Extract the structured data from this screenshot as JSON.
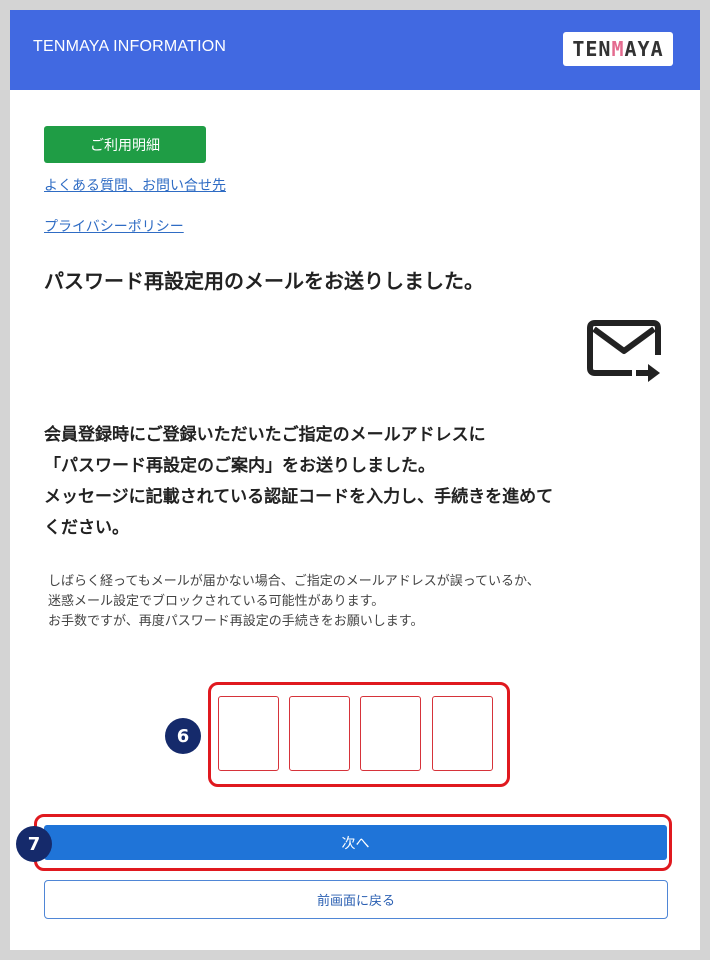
{
  "header": {
    "title": "TENMAYA INFORMATION",
    "logo": {
      "part1": "TEN",
      "part2": "M",
      "part3": "AYA"
    },
    "color": "#4169e1"
  },
  "links": {
    "usage_details": "ご利用明細",
    "faq": "よくある質問、お問い合せ先",
    "privacy": "プライバシーポリシー"
  },
  "main": {
    "heading": "パスワード再設定用のメールをお送りしました。",
    "icon": "mail-send-icon",
    "body_lines": [
      "会員登録時にご登録いただいたご指定のメールアドレスに",
      "「パスワード再設定のご案内」をお送りしました。",
      "メッセージに記載されている認証コードを入力し、手続きを進めて",
      "ください。"
    ],
    "note_lines": [
      "しばらく経ってもメールが届かない場合、ご指定のメールアドレスが誤っているか、",
      "迷惑メール設定でブロックされている可能性があります。",
      "お手数ですが、再度パスワード再設定の手続きをお願いします。"
    ]
  },
  "code": {
    "digits": [
      "",
      "",
      "",
      ""
    ],
    "badge": "6"
  },
  "buttons": {
    "next": "次へ",
    "next_badge": "7",
    "back": "前画面に戻る"
  },
  "colors": {
    "accent": "#1f74d8",
    "green": "#1f9d45",
    "highlight": "#e0191f",
    "badge": "#152a6b"
  }
}
